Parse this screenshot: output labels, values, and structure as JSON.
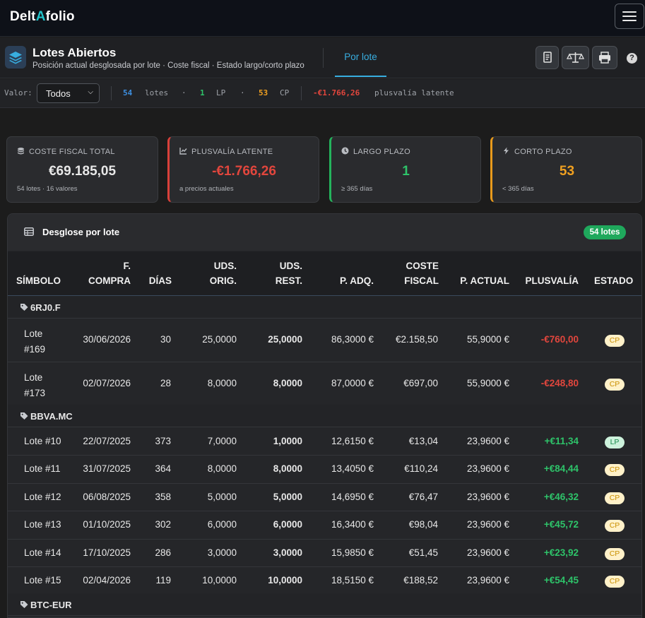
{
  "app": {
    "brand_left": "Delt",
    "brand_mark": "A",
    "brand_right": "folio"
  },
  "header": {
    "title": "Lotes Abiertos",
    "subtitle": "Posición actual desglosada por lote · Coste fiscal · Estado largo/corto plazo",
    "tab": "Por lote",
    "help": "?"
  },
  "filter": {
    "label": "Valor:",
    "selected": "Todos",
    "lotes_count": "54",
    "lotes_label": "lotes",
    "dot": "·",
    "lp_count": "1",
    "lp_label": "LP",
    "cp_count": "53",
    "cp_label": "CP",
    "latent_value": "-€1.766,26",
    "latent_label": "plusvalía latente"
  },
  "cards": [
    {
      "label": "COSTE FISCAL TOTAL",
      "value": "€69.185,05",
      "note": "54 lotes · 16 valores",
      "color": "#ffffff",
      "accent": "#3a3c40",
      "icon": "coins-icon"
    },
    {
      "label": "PLUSVALÍA LATENTE",
      "value": "-€1.766,26",
      "note": "a precios actuales",
      "color": "#e2463d",
      "accent": "#d9403a",
      "icon": "chart-line-icon"
    },
    {
      "label": "LARGO PLAZO",
      "value": "1",
      "note": "≥ 365 días",
      "color": "#2ec46a",
      "accent": "#24b35c",
      "icon": "clock-icon"
    },
    {
      "label": "CORTO PLAZO",
      "value": "53",
      "note": "< 365 días",
      "color": "#f0a020",
      "accent": "#e89a1c",
      "icon": "bolt-icon"
    }
  ],
  "panel": {
    "title": "Desglose por lote",
    "badge": "54 lotes"
  },
  "columns": {
    "simbolo": "SÍMBOLO",
    "fcompra_1": "F.",
    "fcompra_2": "COMPRA",
    "dias": "DÍAS",
    "orig_1": "UDS.",
    "orig_2": "ORIG.",
    "rest_1": "UDS.",
    "rest_2": "REST.",
    "padq": "P. ADQ.",
    "coste_1": "COSTE",
    "coste_2": "FISCAL",
    "pactual": "P. ACTUAL",
    "plusvalia": "PLUSVALÍA",
    "estado": "ESTADO"
  },
  "groups": [
    {
      "symbol": "6RJ0.F",
      "lots": [
        {
          "lote_1": "Lote",
          "lote_2": "#169",
          "fecha": "30/06/2026",
          "dias": "30",
          "orig": "25,0000",
          "rest": "25,0000",
          "padq": "86,3000 €",
          "coste": "€2.158,50",
          "pactual": "55,9000 €",
          "plus": "-€760,00",
          "estado": "CP"
        },
        {
          "lote_1": "Lote",
          "lote_2": "#173",
          "fecha": "02/07/2026",
          "dias": "28",
          "orig": "8,0000",
          "rest": "8,0000",
          "padq": "87,0000 €",
          "coste": "€697,00",
          "pactual": "55,9000 €",
          "plus": "-€248,80",
          "estado": "CP"
        }
      ]
    },
    {
      "symbol": "BBVA.MC",
      "lots": [
        {
          "lote_1": "Lote #10",
          "fecha": "22/07/2025",
          "dias": "373",
          "orig": "7,0000",
          "rest": "1,0000",
          "padq": "12,6150 €",
          "coste": "€13,04",
          "pactual": "23,9600 €",
          "plus": "+€11,34",
          "estado": "LP"
        },
        {
          "lote_1": "Lote #11",
          "fecha": "31/07/2025",
          "dias": "364",
          "orig": "8,0000",
          "rest": "8,0000",
          "padq": "13,4050 €",
          "coste": "€110,24",
          "pactual": "23,9600 €",
          "plus": "+€84,44",
          "estado": "CP"
        },
        {
          "lote_1": "Lote #12",
          "fecha": "06/08/2025",
          "dias": "358",
          "orig": "5,0000",
          "rest": "5,0000",
          "padq": "14,6950 €",
          "coste": "€76,47",
          "pactual": "23,9600 €",
          "plus": "+€46,32",
          "estado": "CP"
        },
        {
          "lote_1": "Lote #13",
          "fecha": "01/10/2025",
          "dias": "302",
          "orig": "6,0000",
          "rest": "6,0000",
          "padq": "16,3400 €",
          "coste": "€98,04",
          "pactual": "23,9600 €",
          "plus": "+€45,72",
          "estado": "CP"
        },
        {
          "lote_1": "Lote #14",
          "fecha": "17/10/2025",
          "dias": "286",
          "orig": "3,0000",
          "rest": "3,0000",
          "padq": "15,9850 €",
          "coste": "€51,45",
          "pactual": "23,9600 €",
          "plus": "+€23,92",
          "estado": "CP"
        },
        {
          "lote_1": "Lote #15",
          "fecha": "02/04/2026",
          "dias": "119",
          "orig": "10,0000",
          "rest": "10,0000",
          "padq": "18,5150 €",
          "coste": "€188,52",
          "pactual": "23,9600 €",
          "plus": "+€54,45",
          "estado": "CP"
        }
      ]
    },
    {
      "symbol": "BTC-EUR",
      "lots": []
    }
  ],
  "colors": {
    "negative": "#e2463d",
    "positive": "#2ec46a",
    "accent": "#38aee0"
  }
}
